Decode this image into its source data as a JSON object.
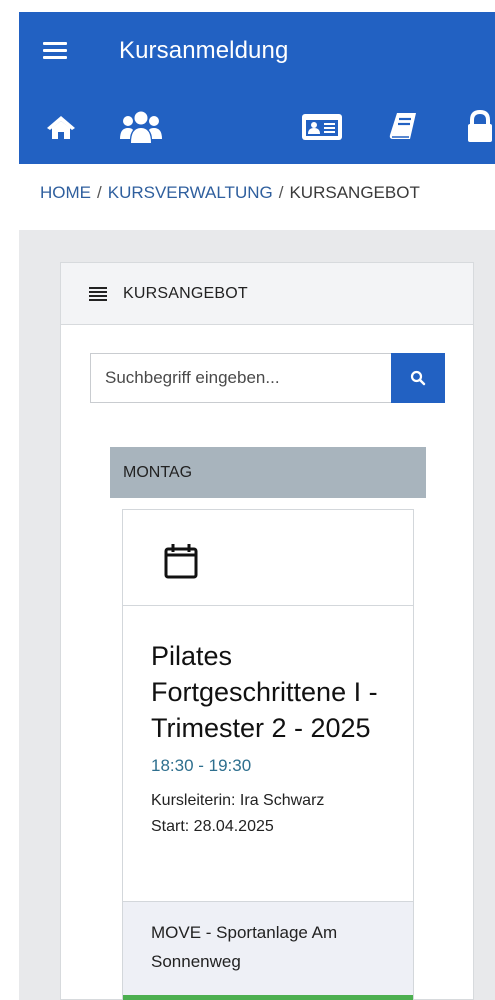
{
  "app": {
    "title": "Kursanmeldung"
  },
  "nav_icons": [
    "home-icon",
    "users-icon",
    "id-card-icon",
    "book-icon",
    "lock-icon"
  ],
  "breadcrumb": {
    "home": "HOME",
    "section": "KURSVERWALTUNG",
    "current": "KURSANGEBOT",
    "separator": "/"
  },
  "panel": {
    "title": "KURSANGEBOT"
  },
  "search": {
    "placeholder": "Suchbegriff eingeben...",
    "value": ""
  },
  "day": {
    "label": "MONTAG"
  },
  "course": {
    "title": "Pilates Fortgeschrittene I - Trimester 2 - 2025",
    "time": "18:30 - 19:30",
    "instructor": "Kursleiterin: Ira Schwarz",
    "start": "Start: 28.04.2025",
    "location": "MOVE - Sportanlage Am Sonnenweg"
  },
  "colors": {
    "primary": "#2261c2",
    "day_header": "#a8b4bd",
    "time": "#2e6f8e",
    "status": "#4caf50"
  }
}
